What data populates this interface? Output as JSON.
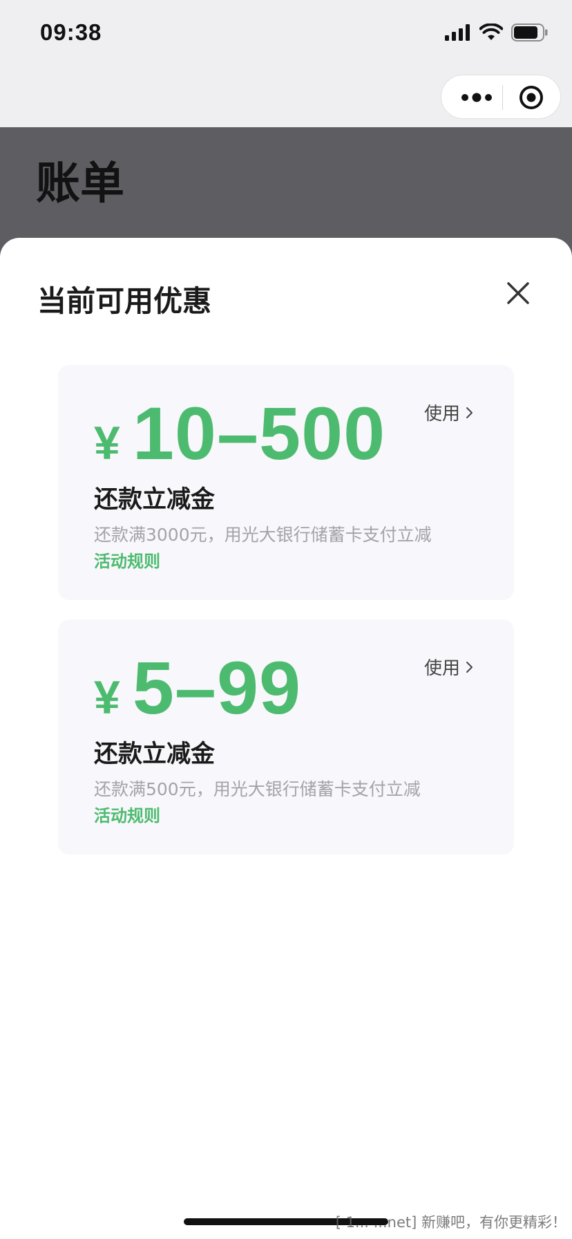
{
  "status_bar": {
    "time": "09:38"
  },
  "capsule": {
    "more_icon": "more-dots-icon",
    "target_icon": "target-icon"
  },
  "page": {
    "title": "账单"
  },
  "sheet": {
    "title": "当前可用优惠",
    "close_icon": "close-icon",
    "coupons": [
      {
        "currency": "¥",
        "amount": "10–500",
        "use_label": "使用",
        "name": "还款立减金",
        "description": "还款满3000元，用光大银行储蓄卡支付立减",
        "rules_label": "活动规则"
      },
      {
        "currency": "¥",
        "amount": "5–99",
        "use_label": "使用",
        "name": "还款立减金",
        "description": "还款满500元，用光大银行储蓄卡支付立减",
        "rules_label": "活动规则"
      }
    ]
  },
  "watermark": "[ 1... ...net] 新赚吧，有你更精彩！",
  "colors": {
    "accent_green": "#4dbb6f",
    "overlay_dim": "#5e5d62"
  }
}
